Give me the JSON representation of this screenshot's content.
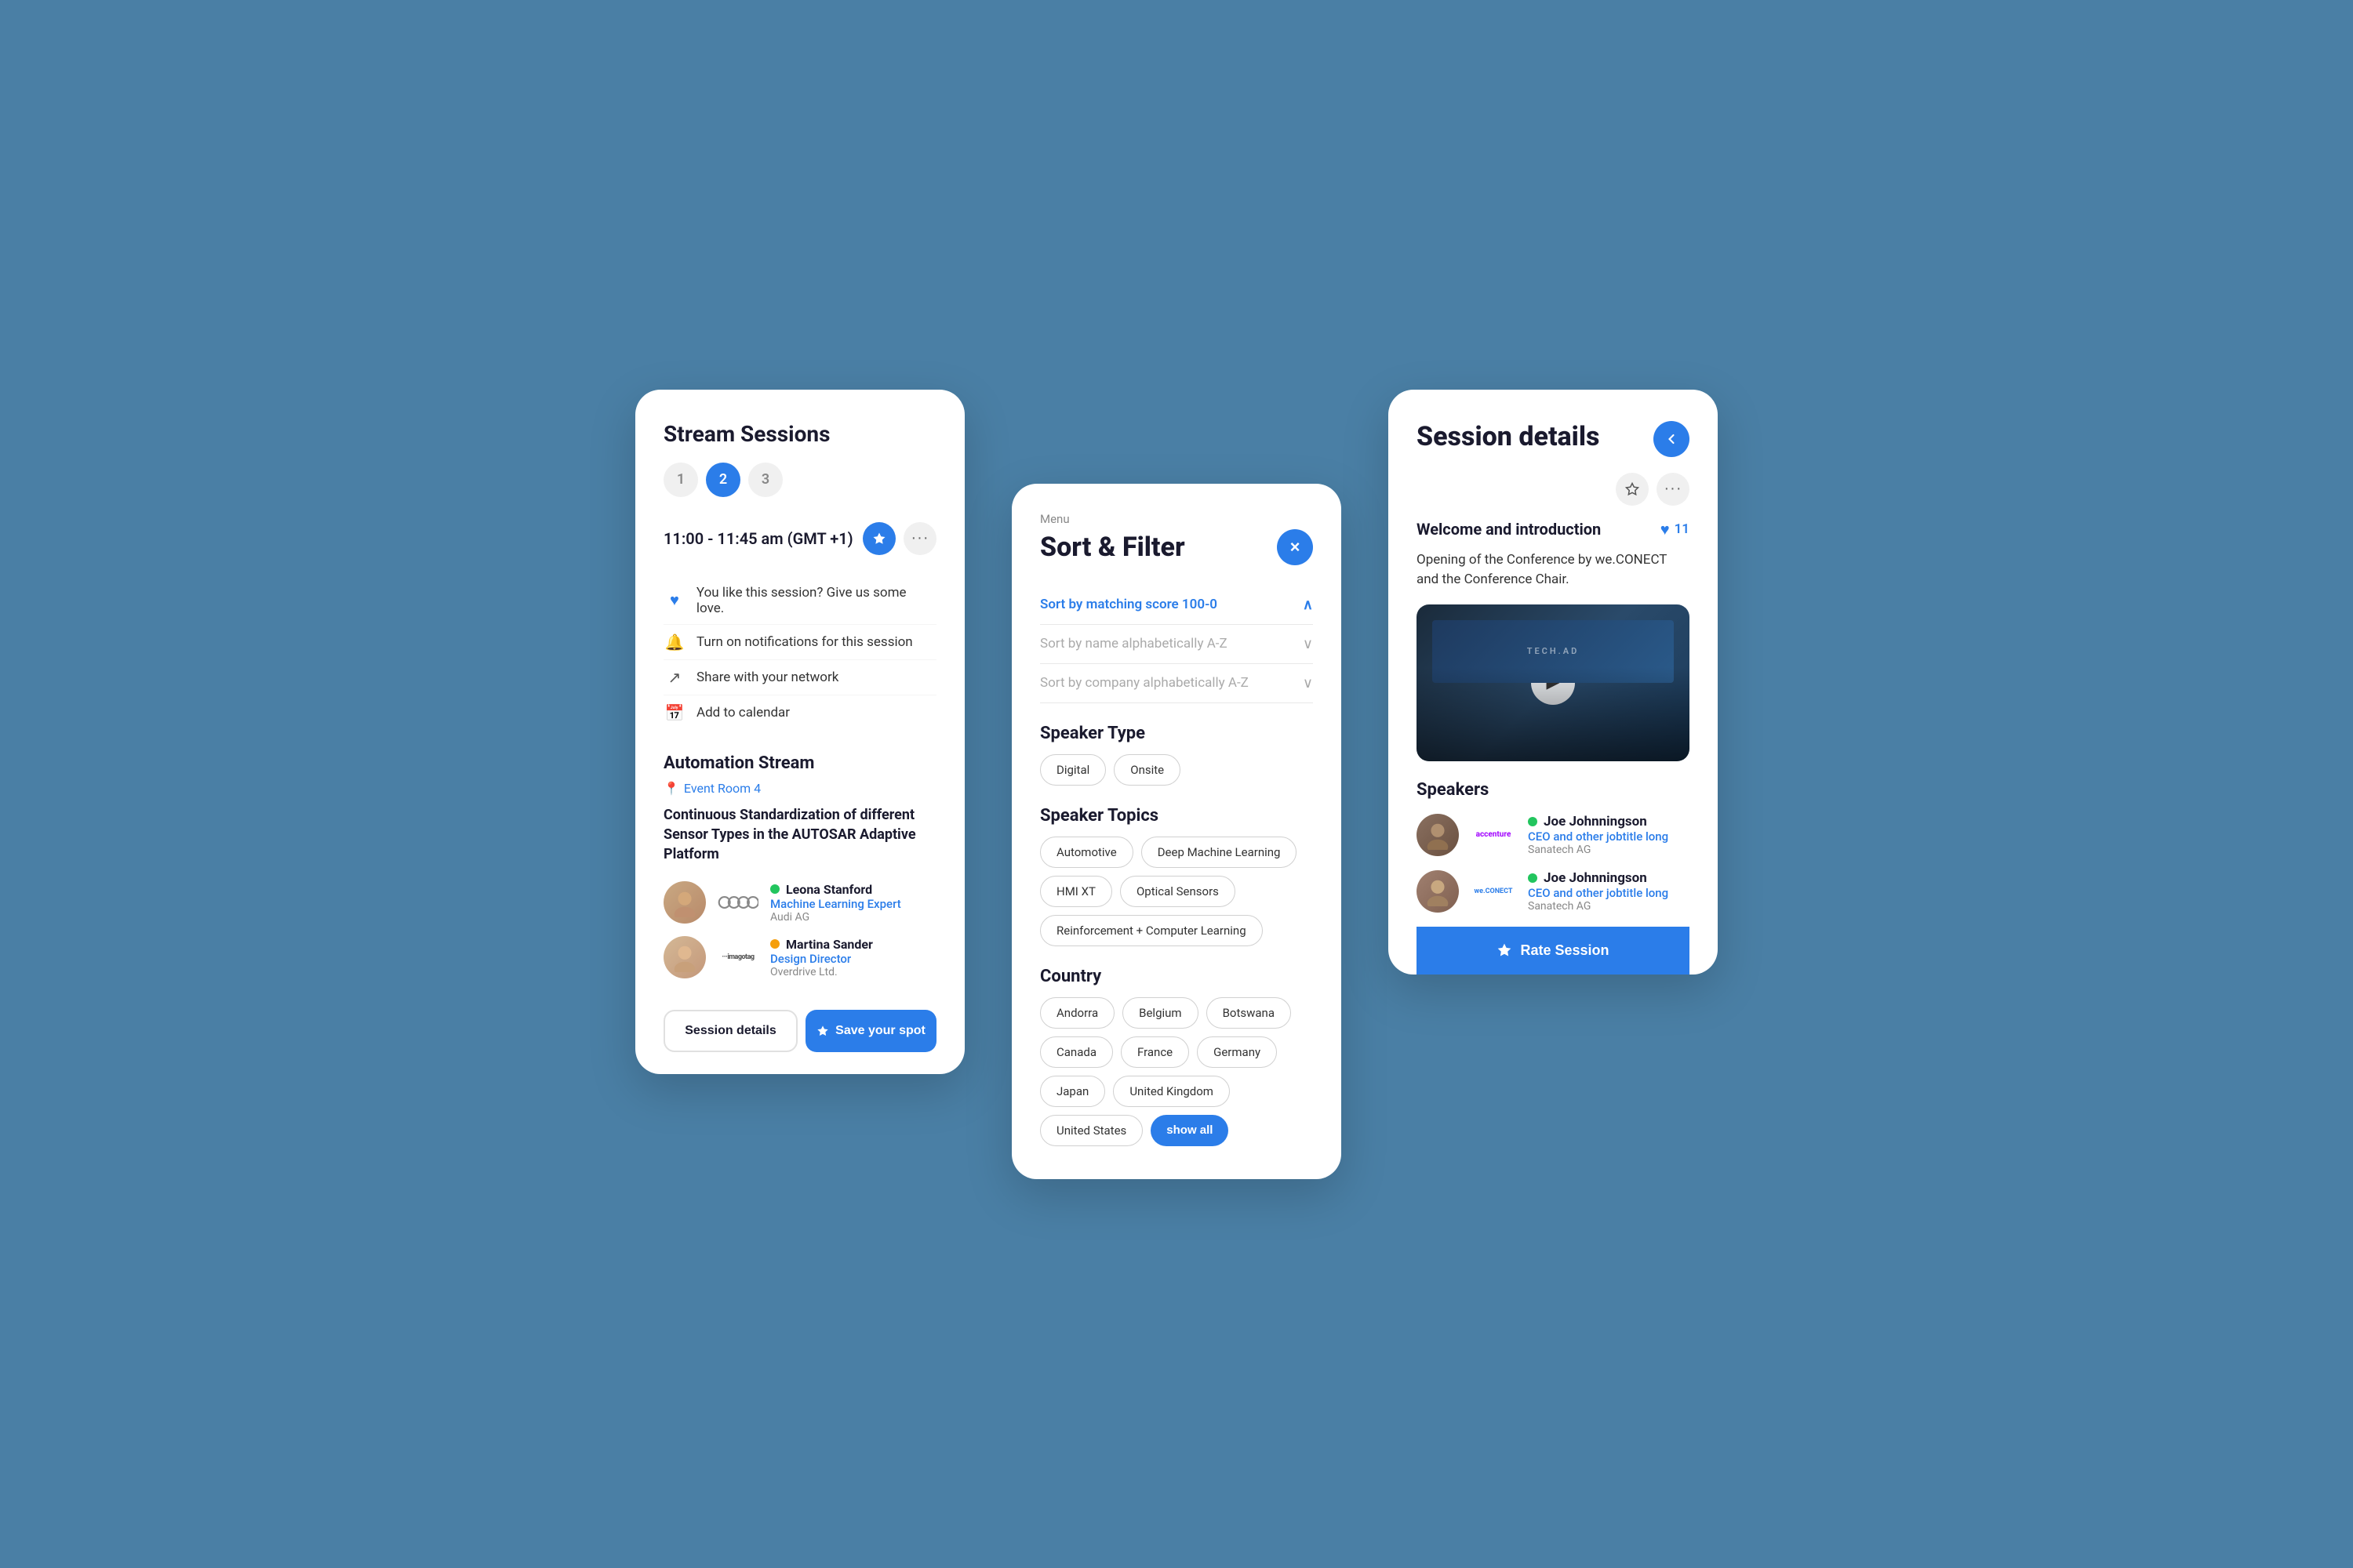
{
  "background": {
    "color": "#4a7fa5"
  },
  "card1": {
    "title": "Stream Sessions",
    "tabs": [
      {
        "label": "1",
        "state": "inactive"
      },
      {
        "label": "2",
        "state": "active"
      },
      {
        "label": "3",
        "state": "inactive"
      }
    ],
    "time": "11:00 - 11:45 am (GMT +1)",
    "actions": [
      {
        "icon": "heart",
        "text": "You like this session? Give us some love."
      },
      {
        "icon": "bell",
        "text": "Turn on notifications for this session"
      },
      {
        "icon": "share",
        "text": "Share with your network"
      },
      {
        "icon": "calendar",
        "text": "Add to calendar"
      }
    ],
    "stream_name": "Automation Stream",
    "location": "Event Room 4",
    "session_name": "Continuous Standardization of different Sensor Types in the AUTOSAR Adaptive Platform",
    "speakers": [
      {
        "name": "Leona Stanford",
        "role": "Machine Learning Expert",
        "company": "Audi AG",
        "status": "green"
      },
      {
        "name": "Martina Sander",
        "role": "Design Director",
        "company": "Overdrive Ltd.",
        "status": "yellow"
      }
    ],
    "buttons": {
      "session_details": "Session details",
      "save_your_spot": "Save your spot"
    }
  },
  "card2": {
    "menu_label": "Menu",
    "title": "Sort & Filter",
    "close_label": "×",
    "sort_options": [
      {
        "label": "Sort by matching score 100-0",
        "active": true
      },
      {
        "label": "Sort by name alphabetically A-Z",
        "active": false
      },
      {
        "label": "Sort by company alphabetically A-Z",
        "active": false
      }
    ],
    "speaker_type_title": "Speaker Type",
    "speaker_types": [
      {
        "label": "Digital"
      },
      {
        "label": "Onsite"
      }
    ],
    "speaker_topics_title": "Speaker Topics",
    "speaker_topics": [
      {
        "label": "Automotive"
      },
      {
        "label": "Deep Machine Learning"
      },
      {
        "label": "HMI XT"
      },
      {
        "label": "Optical Sensors"
      },
      {
        "label": "Reinforcement + Computer Learning"
      }
    ],
    "country_title": "Country",
    "countries": [
      {
        "label": "Andorra"
      },
      {
        "label": "Belgium"
      },
      {
        "label": "Botswana"
      },
      {
        "label": "Canada"
      },
      {
        "label": "France"
      },
      {
        "label": "Germany"
      },
      {
        "label": "Japan"
      },
      {
        "label": "United Kingdom"
      },
      {
        "label": "United States"
      }
    ],
    "show_all_label": "show all"
  },
  "card3": {
    "title": "Session details",
    "back_label": "‹",
    "welcome_title": "Welcome and introduction",
    "like_count": "11",
    "description": "Opening of the Conference by we.CONECT and the Conference Chair.",
    "speakers_title": "Speakers",
    "speakers": [
      {
        "name": "Joe Johnningson",
        "role": "CEO and other jobtitle long",
        "company": "Sanatech AG",
        "logo": "accenture",
        "status": "green"
      },
      {
        "name": "Joe Johnningson",
        "role": "CEO and other jobtitle long",
        "company": "Sanatech AG",
        "logo": "weconect",
        "status": "green"
      }
    ],
    "rate_session_label": "Rate Session"
  }
}
